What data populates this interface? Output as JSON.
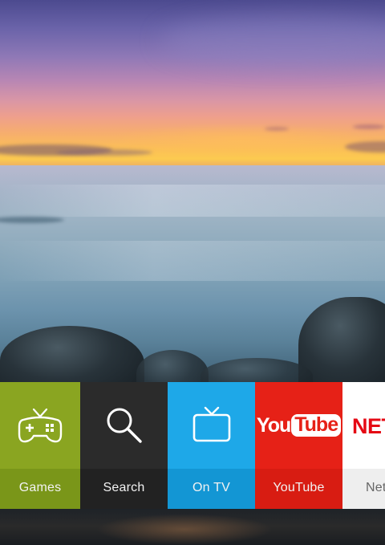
{
  "tiles": [
    {
      "label": "Games",
      "icon": "gamepad-icon",
      "color": "#8aa521"
    },
    {
      "label": "Search",
      "icon": "magnifier-icon",
      "color": "#2b2b2b"
    },
    {
      "label": "On TV",
      "icon": "tv-icon",
      "color": "#1ea8e8"
    },
    {
      "label": "YouTube",
      "icon": "youtube-logo",
      "color": "#e62117",
      "logo_text_a": "You",
      "logo_text_b": "Tube"
    },
    {
      "label": "Netflix",
      "icon": "netflix-logo",
      "color": "#ffffff",
      "logo_text": "NETFLIX",
      "visible_label": "Net"
    }
  ],
  "background": {
    "scene": "sunset-sea-rocks"
  }
}
